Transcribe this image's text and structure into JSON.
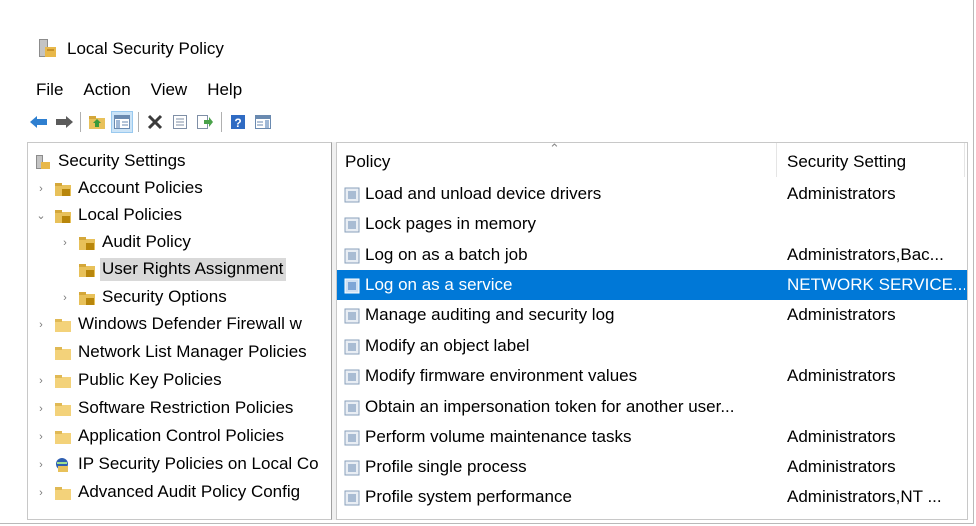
{
  "window": {
    "title": "Local Security Policy"
  },
  "menu": [
    "File",
    "Action",
    "View",
    "Help"
  ],
  "toolbar": {
    "buttons": [
      "back-arrow-icon",
      "forward-arrow-icon",
      "up-folder-icon",
      "show-hide-tree-icon",
      "delete-icon",
      "properties-icon",
      "export-list-icon",
      "help-icon",
      "show-hide-action-pane-icon"
    ]
  },
  "tree": {
    "root": "Security Settings",
    "items": [
      {
        "label": "Account Policies"
      },
      {
        "label": "Local Policies"
      },
      {
        "label": "Audit Policy"
      },
      {
        "label": "User Rights Assignment"
      },
      {
        "label": "Security Options"
      },
      {
        "label": "Windows Defender Firewall w"
      },
      {
        "label": "Network List Manager Policies"
      },
      {
        "label": "Public Key Policies"
      },
      {
        "label": "Software Restriction Policies"
      },
      {
        "label": "Application Control Policies"
      },
      {
        "label": "IP Security Policies on Local Co"
      },
      {
        "label": "Advanced Audit Policy Config"
      }
    ]
  },
  "list": {
    "columns": {
      "policy": "Policy",
      "setting": "Security Setting"
    },
    "rows": [
      {
        "policy": "Load and unload device drivers",
        "setting": "Administrators"
      },
      {
        "policy": "Lock pages in memory",
        "setting": ""
      },
      {
        "policy": "Log on as a batch job",
        "setting": "Administrators,Bac..."
      },
      {
        "policy": "Log on as a service",
        "setting": "NETWORK SERVICE..."
      },
      {
        "policy": "Manage auditing and security log",
        "setting": "Administrators"
      },
      {
        "policy": "Modify an object label",
        "setting": ""
      },
      {
        "policy": "Modify firmware environment values",
        "setting": "Administrators"
      },
      {
        "policy": "Obtain an impersonation token for another user...",
        "setting": ""
      },
      {
        "policy": "Perform volume maintenance tasks",
        "setting": "Administrators"
      },
      {
        "policy": "Profile single process",
        "setting": "Administrators"
      },
      {
        "policy": "Profile system performance",
        "setting": "Administrators,NT ..."
      }
    ]
  },
  "colors": {
    "selection": "#0078d7",
    "tree_selection": "#d9d9d9",
    "folder": "#e8c15a"
  }
}
